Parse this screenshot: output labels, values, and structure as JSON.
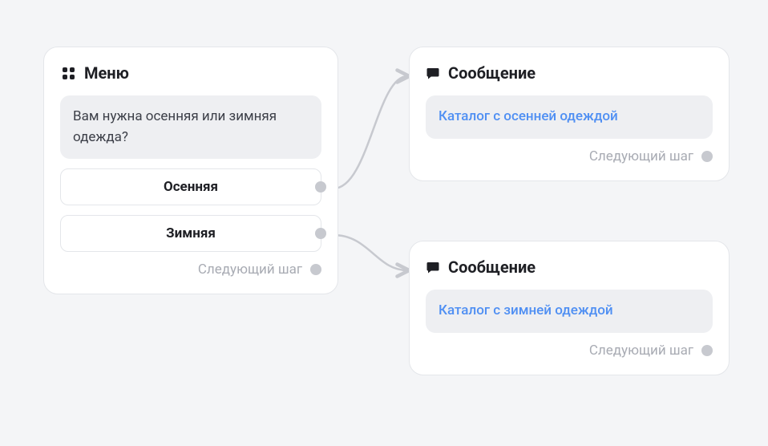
{
  "menu": {
    "title": "Меню",
    "prompt": "Вам нужна осенняя или зимняя одежда?",
    "options": [
      {
        "label": "Осенняя"
      },
      {
        "label": "Зимняя"
      }
    ],
    "nextStep": "Следующий шаг"
  },
  "messages": [
    {
      "title": "Сообщение",
      "body": "Каталог с осенней одеждой",
      "nextStep": "Следующий шаг"
    },
    {
      "title": "Сообщение",
      "body": "Каталог с зимней одеждой",
      "nextStep": "Следующий шаг"
    }
  ],
  "colors": {
    "link": "#4f8ff3",
    "arrow": "#c7c9cf"
  }
}
